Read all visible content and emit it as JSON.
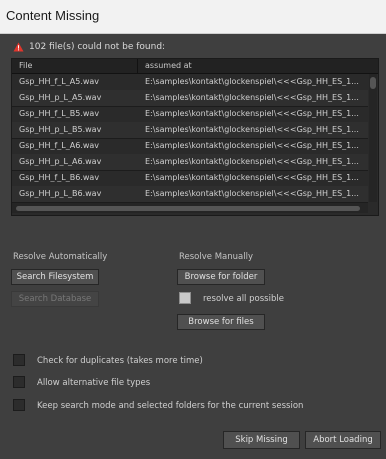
{
  "window": {
    "title": "Content Missing"
  },
  "warning": {
    "icon": "warning-triangle-icon",
    "text": "102 file(s) could not be found:"
  },
  "table": {
    "headers": [
      "File",
      "assumed at"
    ],
    "rows": [
      {
        "file": "Gsp_HH_f_L_A5.wav",
        "path": "E:\\samples\\kontakt\\glockenspiel\\<<<Gsp_HH_ES_1..."
      },
      {
        "file": "Gsp_HH_p_L_A5.wav",
        "path": "E:\\samples\\kontakt\\glockenspiel\\<<<Gsp_HH_ES_1..."
      },
      {
        "file": "Gsp_HH_f_L_B5.wav",
        "path": "E:\\samples\\kontakt\\glockenspiel\\<<<Gsp_HH_ES_1..."
      },
      {
        "file": "Gsp_HH_p_L_B5.wav",
        "path": "E:\\samples\\kontakt\\glockenspiel\\<<<Gsp_HH_ES_1..."
      },
      {
        "file": "Gsp_HH_f_L_A6.wav",
        "path": "E:\\samples\\kontakt\\glockenspiel\\<<<Gsp_HH_ES_1..."
      },
      {
        "file": "Gsp_HH_p_L_A6.wav",
        "path": "E:\\samples\\kontakt\\glockenspiel\\<<<Gsp_HH_ES_1..."
      },
      {
        "file": "Gsp_HH_f_L_B6.wav",
        "path": "E:\\samples\\kontakt\\glockenspiel\\<<<Gsp_HH_ES_1..."
      },
      {
        "file": "Gsp_HH_p_L_B6.wav",
        "path": "E:\\samples\\kontakt\\glockenspiel\\<<<Gsp_HH_ES_1..."
      }
    ]
  },
  "resolve_auto": {
    "heading": "Resolve Automatically",
    "search_filesystem": "Search Filesystem",
    "search_database": "Search Database"
  },
  "resolve_manual": {
    "heading": "Resolve Manually",
    "browse_folder": "Browse for folder",
    "resolve_all": "resolve all possible",
    "resolve_all_checked": false,
    "browse_files": "Browse for files"
  },
  "options": {
    "duplicates": "Check for duplicates (takes more time)",
    "alternative": "Allow alternative file types",
    "keep_mode": "Keep search mode and selected folders for the current session"
  },
  "footer": {
    "skip": "Skip Missing",
    "abort": "Abort Loading"
  },
  "colors": {
    "background": "#3f3f3f",
    "table_bg": "#2a2a2a",
    "warning": "#e0362c"
  }
}
